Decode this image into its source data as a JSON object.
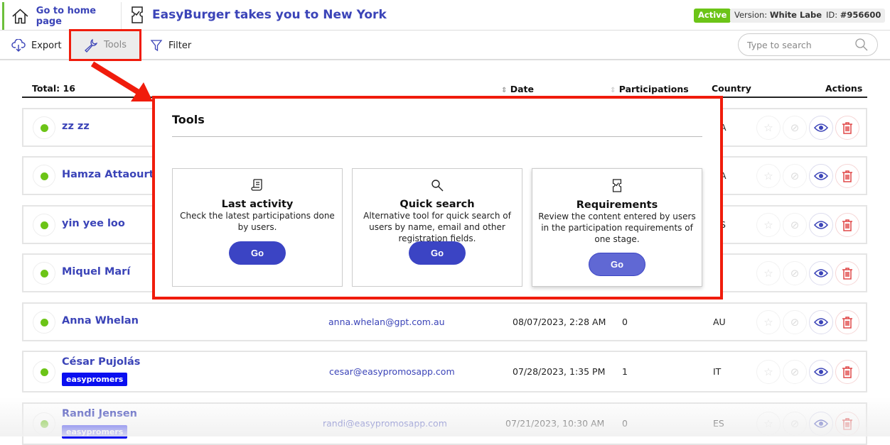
{
  "header": {
    "home_label": "Go to home page",
    "title": "EasyBurger takes you to New York",
    "status": "Active",
    "version_label": "Version:",
    "version_value": "White Label",
    "id_label": "ID:",
    "id_value": "#956600",
    "status_color": "#6cc417"
  },
  "toolbar": {
    "export": "Export",
    "tools": "Tools",
    "filter": "Filter",
    "search_placeholder": "Type to search"
  },
  "table": {
    "total": "Total: 16",
    "columns": {
      "date": "Date",
      "participations": "Participations",
      "country": "Country",
      "actions": "Actions"
    },
    "rows": [
      {
        "name": "zz zz",
        "country": "A"
      },
      {
        "name": "Hamza Attaourti",
        "country": "A"
      },
      {
        "name": "yin yee loo",
        "country": "S"
      },
      {
        "name": "Miquel Marí",
        "country": ""
      },
      {
        "name": "Anna Whelan",
        "email": "anna.whelan@gpt.com.au",
        "date": "08/07/2023, 2:28 AM",
        "participations": "0",
        "country": "AU"
      },
      {
        "name": "César Pujolás",
        "tag": "easypromers",
        "email": "cesar@easypromosapp.com",
        "date": "07/28/2023, 1:35 PM",
        "participations": "1",
        "country": "IT"
      },
      {
        "name": "Randi Jensen",
        "tag": "easypromers",
        "email": "randi@easypromosapp.com",
        "date": "07/21/2023, 10:30 AM",
        "participations": "0",
        "country": "ES"
      }
    ]
  },
  "tools_modal": {
    "title": "Tools",
    "cards": [
      {
        "icon": "scroll-icon",
        "title": "Last activity",
        "desc": "Check the latest participations done by users.",
        "button": "Go"
      },
      {
        "icon": "magnifier-icon",
        "title": "Quick search",
        "desc": "Alternative tool for quick search of users by name, email and other registration fields.",
        "button": "Go"
      },
      {
        "icon": "ticket-check-icon",
        "title": "Requirements",
        "desc": "Review the content entered by users in the participation requirements of one stage.",
        "button": "Go"
      }
    ]
  },
  "accent_color": "#3b44b8",
  "annotation_color": "#f01c0c"
}
